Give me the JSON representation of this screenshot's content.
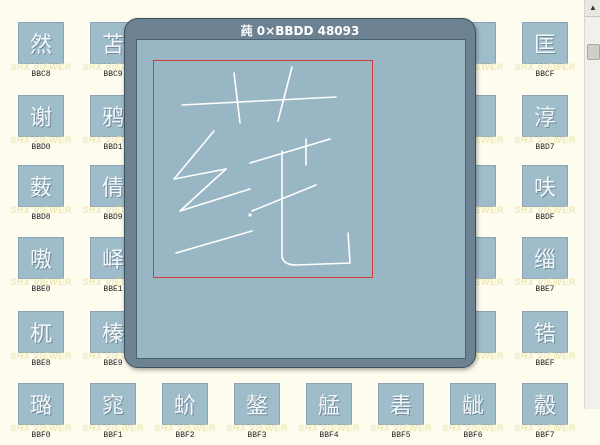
{
  "viewer": {
    "watermark": "SHX VIEWER",
    "grid": [
      {
        "glyph": "然",
        "code": "BBC8"
      },
      {
        "glyph": "苫",
        "code": "BBC9"
      },
      {
        "glyph": "",
        "code": ""
      },
      {
        "glyph": "",
        "code": ""
      },
      {
        "glyph": "",
        "code": ""
      },
      {
        "glyph": "",
        "code": ""
      },
      {
        "glyph": "",
        "code": ""
      },
      {
        "glyph": "匡",
        "code": "BBCF"
      },
      {
        "glyph": "谢",
        "code": "BBD0"
      },
      {
        "glyph": "鸦",
        "code": "BBD1"
      },
      {
        "glyph": "",
        "code": ""
      },
      {
        "glyph": "",
        "code": ""
      },
      {
        "glyph": "",
        "code": ""
      },
      {
        "glyph": "",
        "code": ""
      },
      {
        "glyph": "",
        "code": ""
      },
      {
        "glyph": "淳",
        "code": "BBD7"
      },
      {
        "glyph": "薮",
        "code": "BBD8"
      },
      {
        "glyph": "倩",
        "code": "BBD9"
      },
      {
        "glyph": "",
        "code": ""
      },
      {
        "glyph": "",
        "code": ""
      },
      {
        "glyph": "",
        "code": ""
      },
      {
        "glyph": "",
        "code": ""
      },
      {
        "glyph": "",
        "code": ""
      },
      {
        "glyph": "呋",
        "code": "BBDF"
      },
      {
        "glyph": "嗷",
        "code": "BBE0"
      },
      {
        "glyph": "峄",
        "code": "BBE1"
      },
      {
        "glyph": "",
        "code": ""
      },
      {
        "glyph": "",
        "code": ""
      },
      {
        "glyph": "",
        "code": ""
      },
      {
        "glyph": "",
        "code": ""
      },
      {
        "glyph": "",
        "code": ""
      },
      {
        "glyph": "缁",
        "code": "BBE7"
      },
      {
        "glyph": "杌",
        "code": "BBE8"
      },
      {
        "glyph": "榛",
        "code": "BBE9"
      },
      {
        "glyph": "",
        "code": ""
      },
      {
        "glyph": "",
        "code": ""
      },
      {
        "glyph": "",
        "code": ""
      },
      {
        "glyph": "",
        "code": ""
      },
      {
        "glyph": "",
        "code": ""
      },
      {
        "glyph": "锆",
        "code": "BBEF"
      },
      {
        "glyph": "璐",
        "code": "BBF0"
      },
      {
        "glyph": "窕",
        "code": "BBF1"
      },
      {
        "glyph": "蚧",
        "code": "BBF2"
      },
      {
        "glyph": "鏊",
        "code": "BBF3"
      },
      {
        "glyph": "艋",
        "code": "BBF4"
      },
      {
        "glyph": "砉",
        "code": "BBF5"
      },
      {
        "glyph": "龇",
        "code": "BBF6"
      },
      {
        "glyph": "觳",
        "code": "BBF7"
      }
    ],
    "partial_codes": {
      "row2_col6": "6",
      "row3_col6": "E",
      "row4_col6": "6",
      "row1_col6": "E"
    },
    "accent_colors": {
      "tile": "#9fbccb",
      "frame": "#d43b3b",
      "dialog": "#6c8292"
    }
  },
  "dialog": {
    "title": "莼 0×BBDD 48093"
  }
}
